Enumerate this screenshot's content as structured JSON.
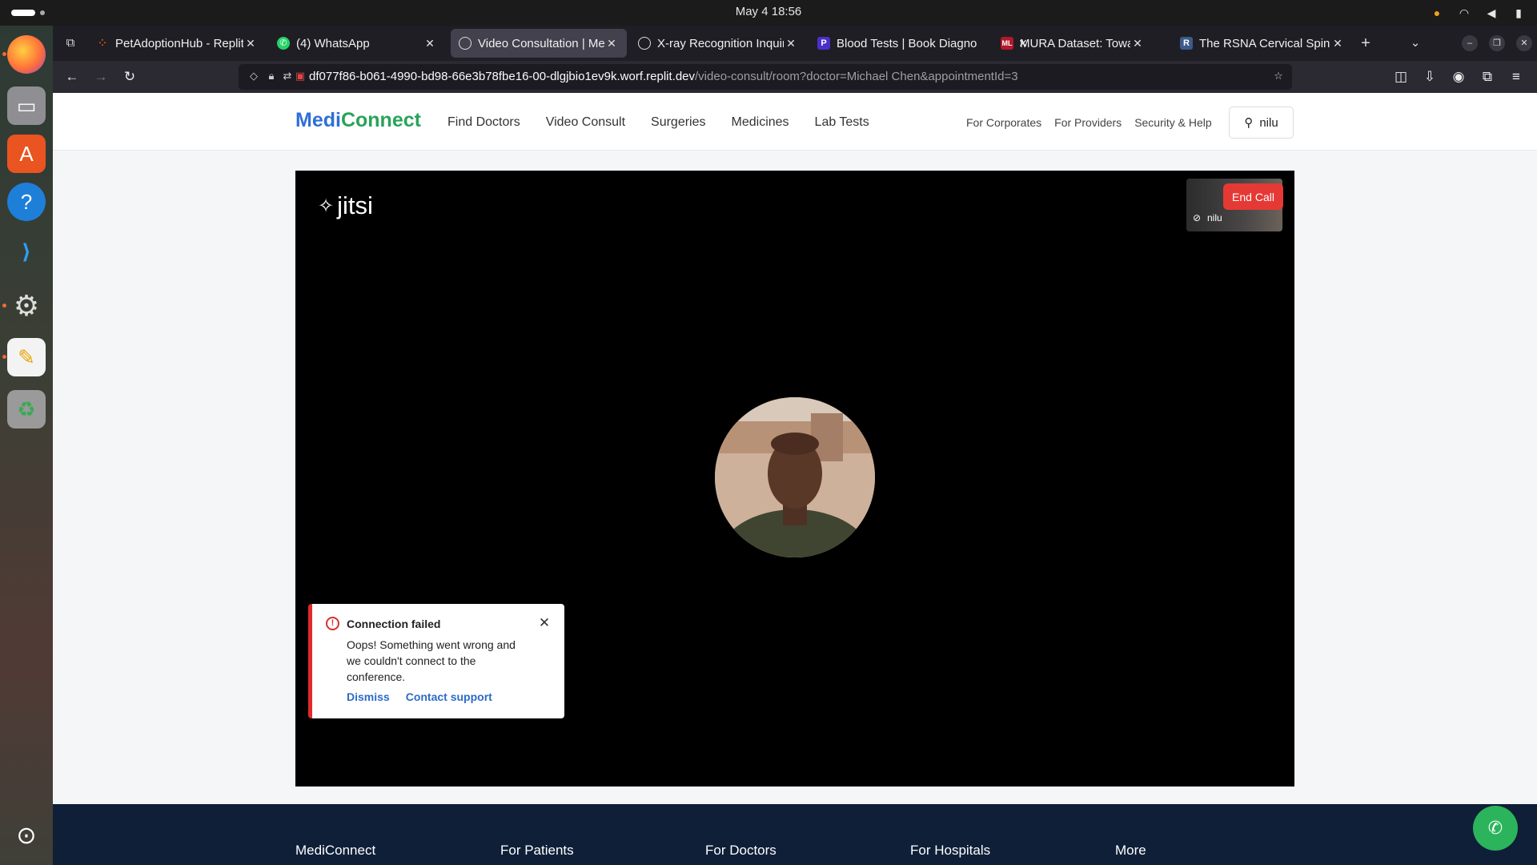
{
  "system": {
    "clock": "May 4  18:56",
    "tray_icons": [
      "microphone-icon",
      "wifi-icon",
      "volume-icon",
      "battery-icon"
    ]
  },
  "dock": {
    "apps": [
      "firefox",
      "files",
      "app-center",
      "help",
      "vscode",
      "settings",
      "text-editor",
      "trash",
      "show-apps"
    ]
  },
  "browser": {
    "tabs": [
      {
        "title": "PetAdoptionHub - Replit",
        "favicon": "replit-icon",
        "active": false
      },
      {
        "title": "(4) WhatsApp",
        "favicon": "whatsapp-icon",
        "active": false
      },
      {
        "title": "Video Consultation | Medi",
        "favicon": "globe-icon",
        "active": true
      },
      {
        "title": "X-ray Recognition Inquiry",
        "favicon": "openai-icon",
        "active": false
      },
      {
        "title": "Blood Tests | Book Diagno",
        "favicon": "p-icon",
        "active": false
      },
      {
        "title": "MURA Dataset: Towards R",
        "favicon": "ml-icon",
        "active": false
      },
      {
        "title": "The RSNA Cervical Spine F",
        "favicon": "r-icon",
        "active": false
      }
    ],
    "url_host": "df077f86-b061-4990-bd98-66e3b78fbe16-00-dlgjbio1ev9k.worf.replit.dev",
    "url_path": "/video-consult/room?doctor=Michael Chen&appointmentId=3"
  },
  "site": {
    "logo_part1": "Medi",
    "logo_part2": "Connect",
    "nav": [
      "Find Doctors",
      "Video Consult",
      "Surgeries",
      "Medicines",
      "Lab Tests"
    ],
    "subnav": [
      "For Corporates",
      "For Providers",
      "Security & Help"
    ],
    "user_name": "nilu"
  },
  "call": {
    "brand": "jitsi",
    "end_call_label": "End Call",
    "participant_name": "nilu",
    "toast": {
      "title": "Connection failed",
      "message": "Oops! Something went wrong and we couldn't connect to the conference.",
      "dismiss_label": "Dismiss",
      "support_label": "Contact support"
    }
  },
  "footer": {
    "columns": [
      "MediConnect",
      "For Patients",
      "For Doctors",
      "For Hospitals",
      "More"
    ]
  },
  "colors": {
    "brand_blue": "#2f6fd6",
    "brand_green": "#29a35a",
    "end_call_red": "#e53935",
    "whatsapp_green": "#2bb45b"
  }
}
